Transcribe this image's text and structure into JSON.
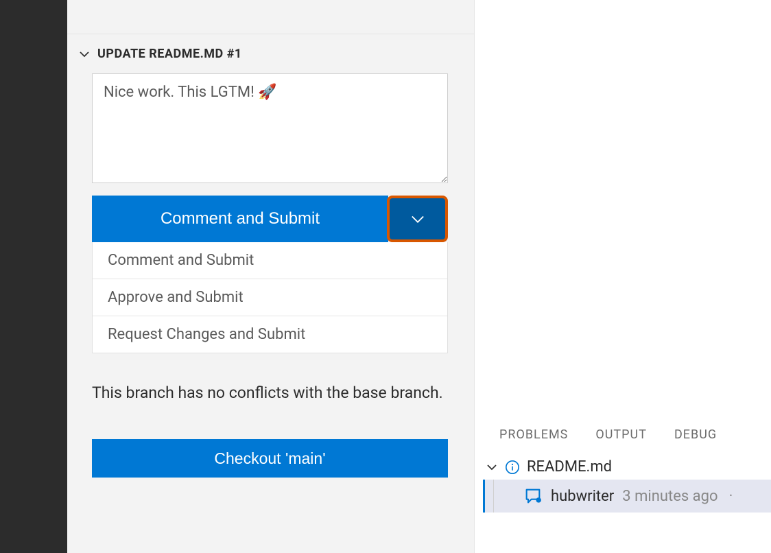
{
  "pr": {
    "header": "UPDATE README.MD #1",
    "comment_value": "Nice work. This LGTM! 🚀",
    "submit_label": "Comment and Submit",
    "dropdown_options": [
      "Comment and Submit",
      "Approve and Submit",
      "Request Changes and Submit"
    ],
    "conflicts_text": "This branch has no conflicts with the base branch.",
    "checkout_label": "Checkout 'main'"
  },
  "bottom_tabs": [
    "PROBLEMS",
    "OUTPUT",
    "DEBUG"
  ],
  "tree": {
    "file": "README.md",
    "item": {
      "user": "hubwriter",
      "time": "3 minutes ago",
      "sep": "·"
    }
  }
}
